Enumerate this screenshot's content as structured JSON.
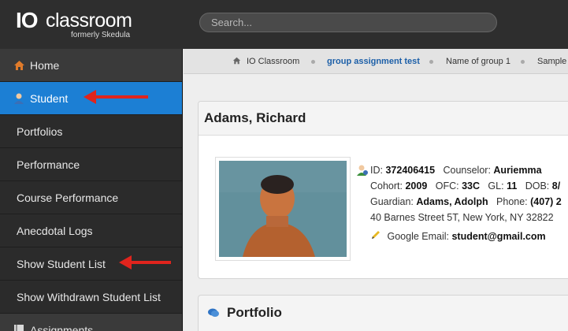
{
  "header": {
    "logo_mark": "IO",
    "logo_name": "classroom",
    "logo_sub": "formerly Skedula",
    "search_placeholder": "Search..."
  },
  "sidebar": {
    "items": [
      {
        "label": "Home",
        "icon": "home-icon"
      },
      {
        "label": "Student",
        "icon": "student-icon",
        "active": true
      },
      {
        "label": "Portfolios"
      },
      {
        "label": "Performance"
      },
      {
        "label": "Course Performance"
      },
      {
        "label": "Anecdotal Logs"
      },
      {
        "label": "Show Student List"
      },
      {
        "label": "Show Withdrawn Student List"
      },
      {
        "label": "Assignments",
        "icon": "book-icon"
      }
    ]
  },
  "breadcrumb": {
    "items": [
      "IO Classroom",
      "group assignment test",
      "Name of group 1",
      "Sample"
    ]
  },
  "student": {
    "name": "Adams, Richard",
    "id_label": "ID:",
    "id": "372406415",
    "counselor_label": "Counselor:",
    "counselor": "Auriemma",
    "cohort_label": "Cohort:",
    "cohort": "2009",
    "ofc_label": "OFC:",
    "ofc": "33C",
    "gl_label": "GL:",
    "gl": "11",
    "dob_label": "DOB:",
    "dob": "8/",
    "guardian_label": "Guardian:",
    "guardian": "Adams, Adolph",
    "phone_label": "Phone:",
    "phone": "(407) 2",
    "address": "40 Barnes Street 5T, New York, NY 32822",
    "email_label": "Google Email:",
    "email": "student@gmail.com"
  },
  "portfolio": {
    "title": "Portfolio"
  },
  "colors": {
    "active": "#1c7fd4",
    "arrow": "#e0241d",
    "header": "#2e2e2e",
    "sidebar": "#2b2b2b"
  }
}
